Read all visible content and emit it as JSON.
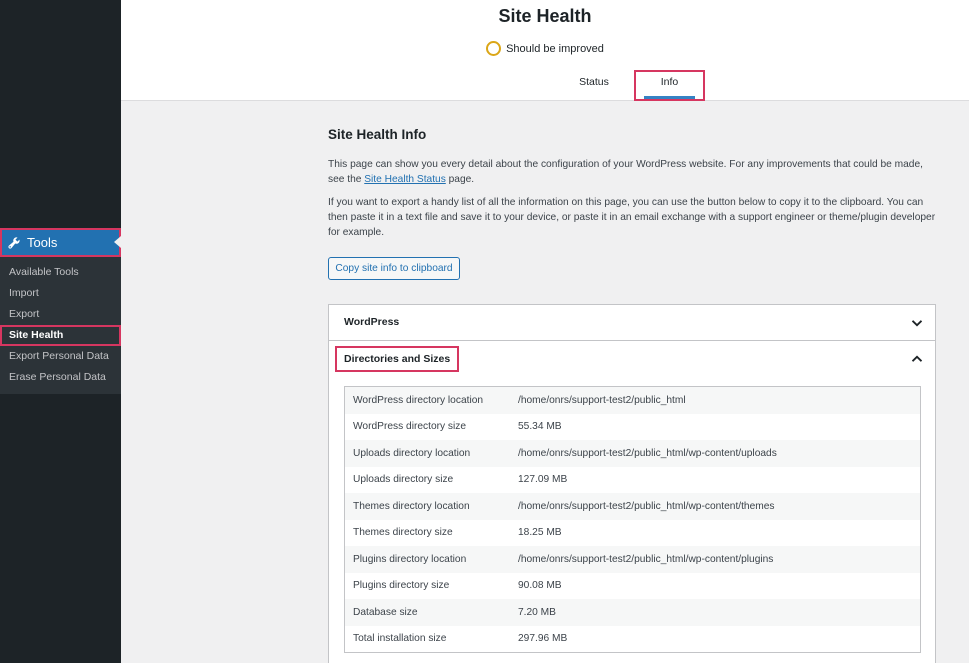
{
  "sidebar": {
    "tools_label": "Tools",
    "submenu": [
      {
        "label": "Available Tools"
      },
      {
        "label": "Import"
      },
      {
        "label": "Export"
      },
      {
        "label": "Site Health",
        "current": true
      },
      {
        "label": "Export Personal Data"
      },
      {
        "label": "Erase Personal Data"
      }
    ]
  },
  "header": {
    "title": "Site Health",
    "status": "Should be improved",
    "tabs": [
      {
        "label": "Status"
      },
      {
        "label": "Info",
        "active": true
      }
    ]
  },
  "main": {
    "heading": "Site Health Info",
    "p1_before": "This page can show you every detail about the configuration of your WordPress website. For any improvements that could be made, see the ",
    "p1_link": "Site Health Status",
    "p1_after": " page.",
    "p2": "If you want to export a handy list of all the information on this page, you can use the button below to copy it to the clipboard. You can then paste it in a text file and save it to your device, or paste it in an email exchange with a support engineer or theme/plugin developer for example.",
    "copy_button": "Copy site info to clipboard",
    "sections": [
      {
        "title": "WordPress",
        "expanded": false
      },
      {
        "title": "Directories and Sizes",
        "expanded": true
      }
    ],
    "directories": [
      {
        "label": "WordPress directory location",
        "value": "/home/onrs/support-test2/public_html"
      },
      {
        "label": "WordPress directory size",
        "value": "55.34 MB"
      },
      {
        "label": "Uploads directory location",
        "value": "/home/onrs/support-test2/public_html/wp-content/uploads"
      },
      {
        "label": "Uploads directory size",
        "value": "127.09 MB"
      },
      {
        "label": "Themes directory location",
        "value": "/home/onrs/support-test2/public_html/wp-content/themes"
      },
      {
        "label": "Themes directory size",
        "value": "18.25 MB"
      },
      {
        "label": "Plugins directory location",
        "value": "/home/onrs/support-test2/public_html/wp-content/plugins"
      },
      {
        "label": "Plugins directory size",
        "value": "90.08 MB"
      },
      {
        "label": "Database size",
        "value": "7.20 MB"
      },
      {
        "label": "Total installation size",
        "value": "297.96 MB"
      }
    ]
  },
  "colors": {
    "sidebar_bg": "#1d2327",
    "accent": "#2271b1",
    "highlight": "#d63660",
    "warning": "#dba617"
  },
  "icons": {
    "tools": "wrench-icon",
    "status": "circle-icon",
    "expand": "chevron-down-icon",
    "collapse": "chevron-up-icon"
  }
}
